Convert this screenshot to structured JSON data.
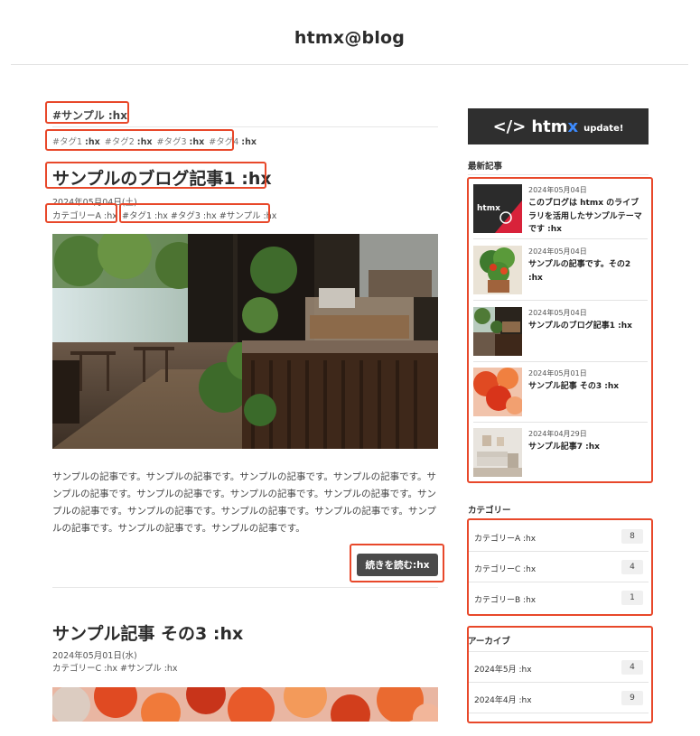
{
  "site": {
    "title": "htmx@blog"
  },
  "listing": {
    "heading": "#サンプル :hx",
    "tags": [
      {
        "text": "#タグ1",
        "suffix": ":hx"
      },
      {
        "text": "#タグ2",
        "suffix": ":hx"
      },
      {
        "text": "#タグ3",
        "suffix": ":hx"
      },
      {
        "text": "#タグ4",
        "suffix": ":hx"
      }
    ]
  },
  "posts": [
    {
      "title": "サンプルのブログ記事1 :hx",
      "date": "2024年05月04日(土)",
      "category": "カテゴリーA :hx",
      "tags": "#タグ1 :hx  #タグ3 :hx  #サンプル :hx",
      "excerpt": "サンプルの記事です。サンプルの記事です。サンプルの記事です。サンプルの記事です。サンプルの記事です。サンプルの記事です。サンプルの記事です。サンプルの記事です。サンプルの記事です。サンプルの記事です。サンプルの記事です。サンプルの記事です。サンプルの記事です。サンプルの記事です。サンプルの記事です。",
      "read_more": "続きを読む:hx"
    },
    {
      "title": "サンプル記事 その3 :hx",
      "date": "2024年05月01日(水)",
      "meta": "カテゴリーC :hx  #サンプル :hx"
    }
  ],
  "sidebar": {
    "banner": {
      "code": "</>",
      "word_main": "htm",
      "word_x": "x",
      "update": "update!"
    },
    "recent_label": "最新記事",
    "recent": [
      {
        "date": "2024年05月04日",
        "title": "このブログは htmx のライブラリを活用したサンプルテーマです :hx",
        "thumb_text": "htmx"
      },
      {
        "date": "2024年05月04日",
        "title": "サンプルの記事です。その2 :hx"
      },
      {
        "date": "2024年05月04日",
        "title": "サンプルのブログ記事1 :hx"
      },
      {
        "date": "2024年05月01日",
        "title": "サンプル記事 その3 :hx"
      },
      {
        "date": "2024年04月29日",
        "title": "サンプル記事7 :hx"
      }
    ],
    "category_label": "カテゴリー",
    "categories": [
      {
        "name": "カテゴリーA :hx",
        "count": "8"
      },
      {
        "name": "カテゴリーC :hx",
        "count": "4"
      },
      {
        "name": "カテゴリーB :hx",
        "count": "1"
      }
    ],
    "archive_label": "アーカイブ",
    "archives": [
      {
        "name": "2024年5月 :hx",
        "count": "4"
      },
      {
        "name": "2024年4月 :hx",
        "count": "9"
      }
    ]
  },
  "colors": {
    "highlight": "#e8482a",
    "button": "#4a4a4a",
    "banner": "#2f2f2f",
    "accent": "#3d8bff"
  }
}
